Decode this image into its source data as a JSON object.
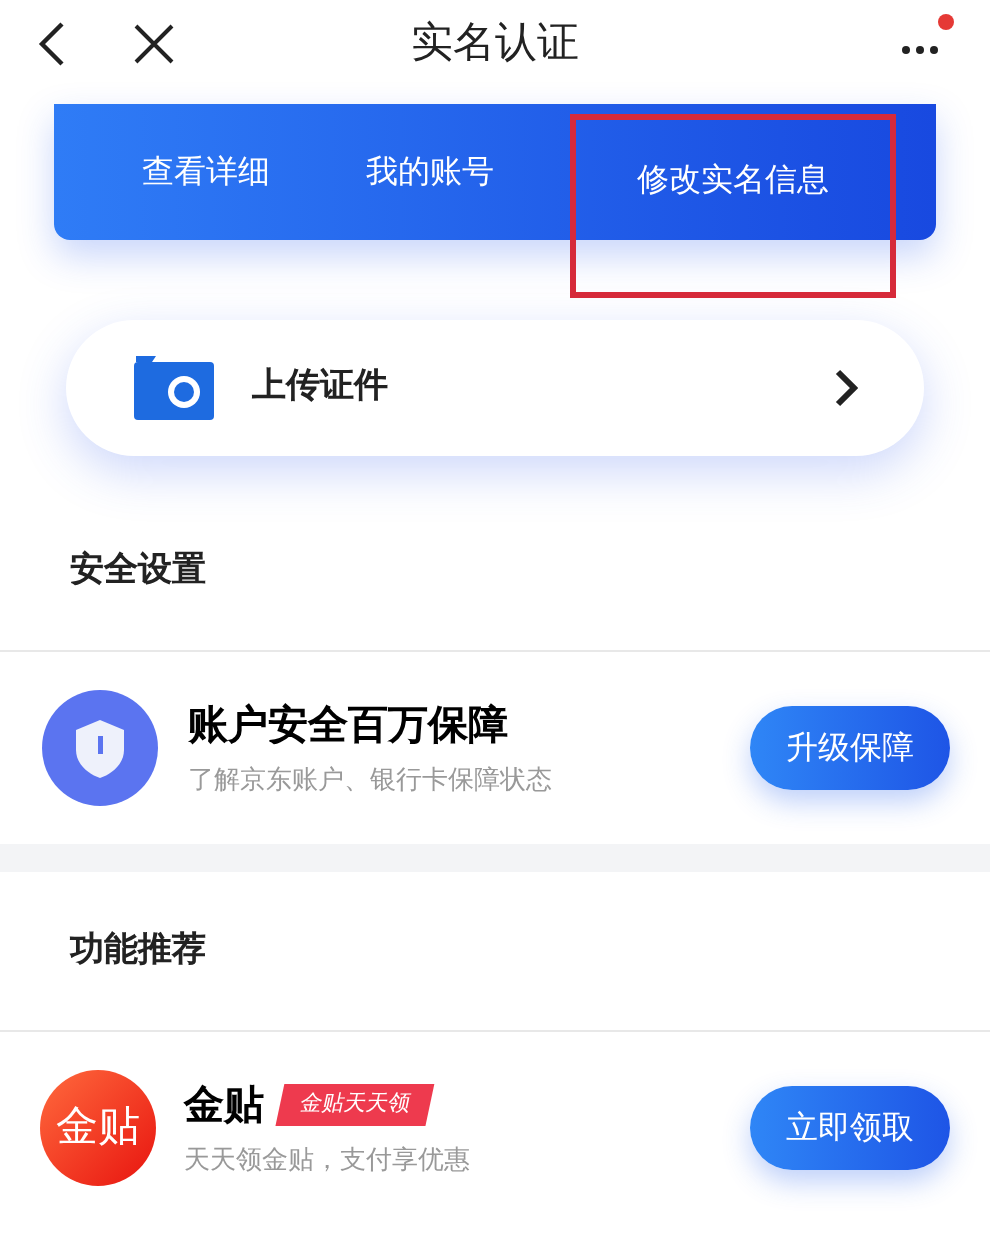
{
  "header": {
    "title": "实名认证",
    "notification_dot": true
  },
  "banner_links": [
    {
      "label": "查看详细",
      "highlighted": false
    },
    {
      "label": "我的账号",
      "highlighted": false
    },
    {
      "label": "修改实名信息",
      "highlighted": true
    }
  ],
  "upload": {
    "label": "上传证件"
  },
  "sections": [
    {
      "title": "安全设置",
      "item": {
        "kind": "shield",
        "title": "账户安全百万保障",
        "subtitle": "了解京东账户、银行卡保障状态",
        "button": "升级保障"
      }
    },
    {
      "title": "功能推荐",
      "item": {
        "kind": "coin",
        "icon_text": "金贴",
        "title": "金贴",
        "tag": "金贴天天领",
        "subtitle": "天天领金贴，支付享优惠",
        "button": "立即领取"
      }
    }
  ]
}
